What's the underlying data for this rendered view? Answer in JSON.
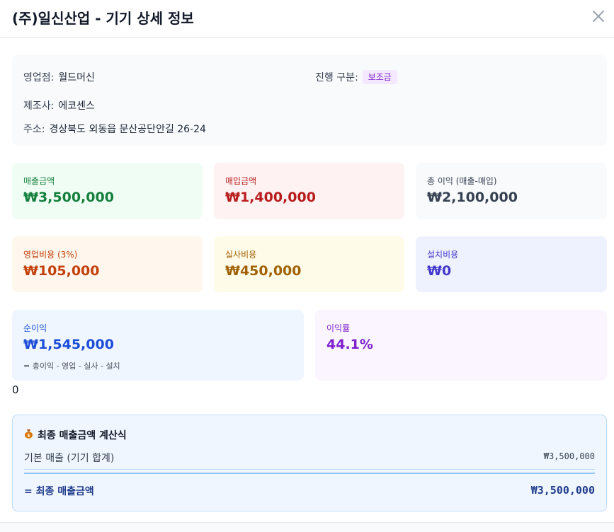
{
  "modal": {
    "title": "(주)일신산업 - 기기 상세 정보",
    "close_icon": "close-icon"
  },
  "info": {
    "branch_label": "영업점:",
    "branch_value": "월드머신",
    "category_label": "진행 구분:",
    "category_badge": "보조금",
    "maker_label": "제조사:",
    "maker_value": "에코센스",
    "address_label": "주소:",
    "address_value": "경상북도 외동읍 문산공단안길 26-24"
  },
  "cards": {
    "sales": {
      "label": "매출금액",
      "value": "₩3,500,000"
    },
    "purchase": {
      "label": "매입금액",
      "value": "₩1,400,000"
    },
    "gross": {
      "label": "총 이익 (매출-매입)",
      "value": "₩2,100,000"
    },
    "sales_cost": {
      "label": "영업비용 (3%)",
      "value": "₩105,000"
    },
    "survey_cost": {
      "label": "실사비용",
      "value": "₩450,000"
    },
    "install_cost": {
      "label": "설치비용",
      "value": "₩0"
    },
    "net": {
      "label": "순이익",
      "value": "₩1,545,000",
      "note": "= 총이익 - 영업 - 실사 - 설치"
    },
    "margin": {
      "label": "이익률",
      "value": "44.1%"
    }
  },
  "stray_text": "0",
  "formula": {
    "icon": "money-bag-icon",
    "title": "최종 매출금액 계산식",
    "base_label": "기본 매출 (기기 합계)",
    "base_value": "₩3,500,000",
    "total_label": "= 최종 매출금액",
    "total_value": "₩3,500,000"
  },
  "colors": {
    "sales": "#15803d",
    "purchase": "#b91c1c",
    "gross": "#374151",
    "sales_cost": "#c2410c",
    "survey_cost": "#a16207",
    "install_cost": "#4338ca",
    "net": "#1d4ed8",
    "margin": "#7e22ce",
    "badge_bg": "#f3e8ff"
  }
}
